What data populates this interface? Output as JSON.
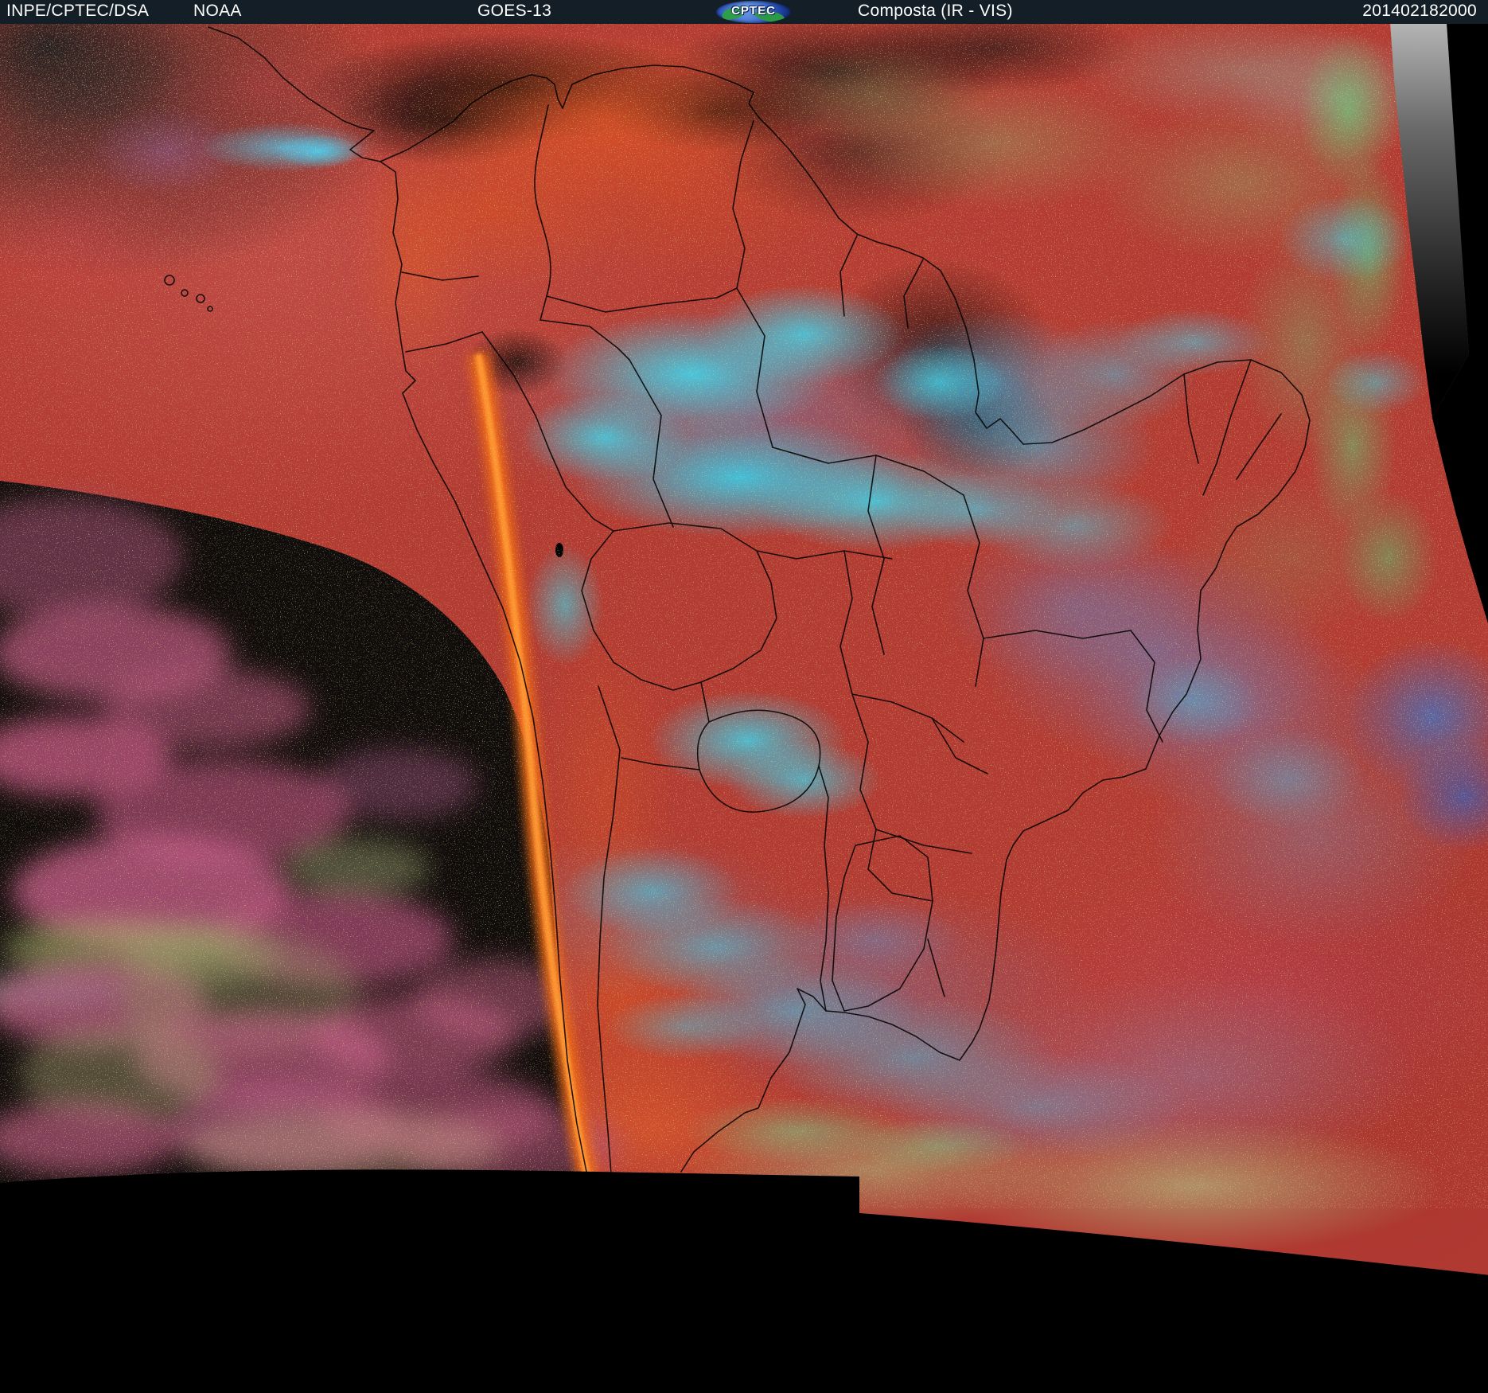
{
  "header": {
    "agency": "INPE/CPTEC/DSA",
    "agency2": "NOAA",
    "satellite": "GOES-13",
    "logo_text": "CPTEC",
    "product": "Composta (IR - VIS)",
    "timestamp": "201402182000"
  },
  "image": {
    "alt": "GOES-13 false-color composite (infrared - visible) satellite image of South America",
    "palette": {
      "header_background": "#131e27",
      "header_text": "#ffffff",
      "warm_surface_red": "#b23b33",
      "hot_land_orange": "#ef6916",
      "cold_cloud_cyan": "#3ad2f2",
      "mid_cloud_blue": "#5b86c8",
      "low_cloud_pink": "#c55f86",
      "haze_olive": "#9aa06a",
      "ocean_black": "#0a0a0a",
      "limb_grey": "#9a9a9a",
      "space_black": "#000000",
      "border_line": "#000000",
      "logo_globe_blue": "#3b67cc",
      "logo_land_green": "#2f9e48"
    }
  }
}
